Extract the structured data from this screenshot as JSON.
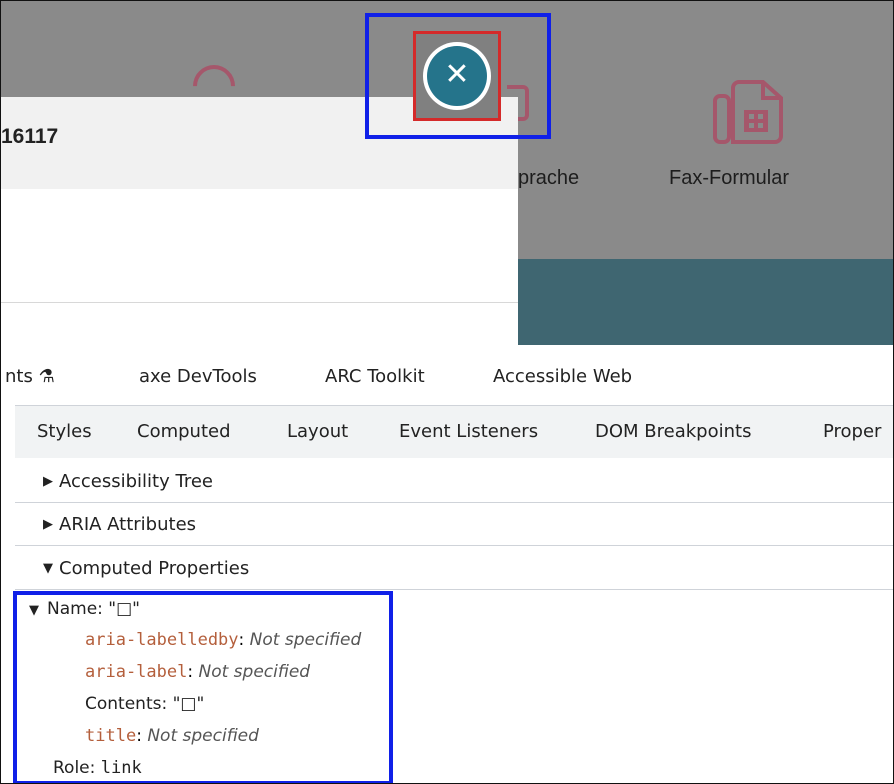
{
  "page": {
    "nav": {
      "sprache": "prache",
      "fax": "Fax-Formular"
    },
    "dialog": {
      "title": "16117",
      "close_glyph": "✕"
    }
  },
  "devtools": {
    "main_tabs": [
      "nts ⚗",
      "axe DevTools",
      "ARC Toolkit",
      "Accessible Web"
    ],
    "sub_tabs": [
      "Styles",
      "Computed",
      "Layout",
      "Event Listeners",
      "DOM Breakpoints",
      "Proper"
    ],
    "sections": [
      {
        "arrow": "▶",
        "label": "Accessibility Tree"
      },
      {
        "arrow": "▶",
        "label": "ARIA Attributes"
      },
      {
        "arrow": "▼",
        "label": "Computed Properties"
      }
    ],
    "props": {
      "name_arrow": "▼",
      "name_label": "Name: \"□\"",
      "labelledby_key": "aria-labelledby",
      "label_key": "aria-label",
      "title_key": "title",
      "colon": ": ",
      "not_specified": "Not specified",
      "contents": "Contents: \"□\"",
      "role_label": "Role: ",
      "role_value": "link"
    }
  },
  "colors": {
    "highlight_blue": "#1020e8",
    "focus_red": "#d42a2a",
    "close_teal": "#25748b",
    "icon_magenta": "#a5576b",
    "code_key": "#b45f3c"
  }
}
